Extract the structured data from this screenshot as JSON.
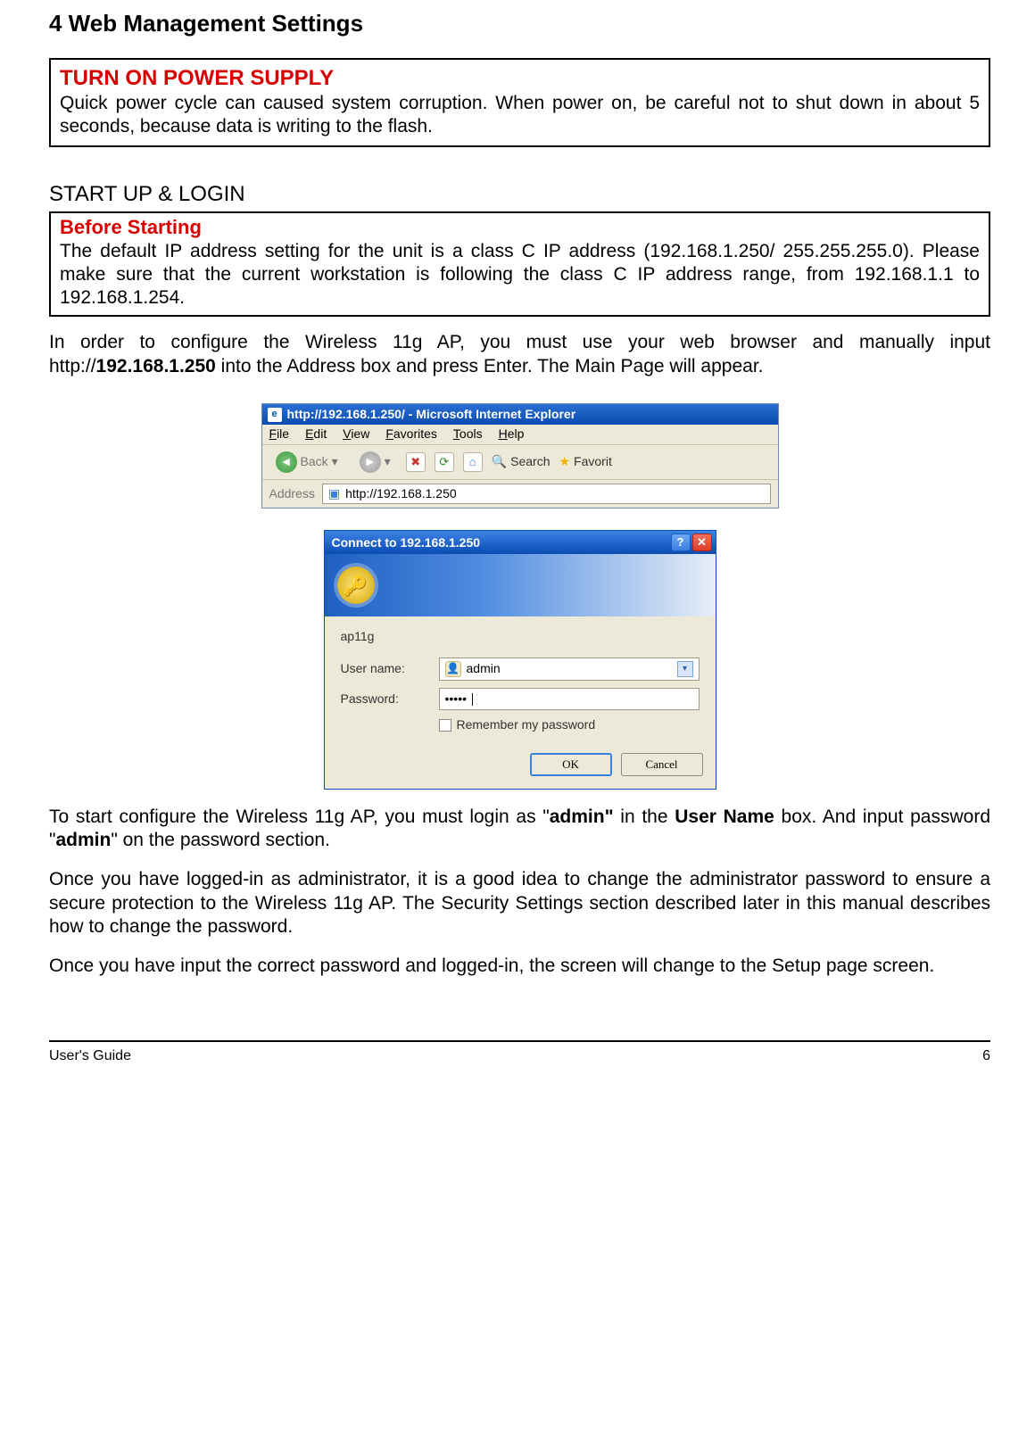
{
  "page": {
    "title": "4 Web Management Settings",
    "footer_left": "User's Guide",
    "footer_right": "6"
  },
  "warning": {
    "title": "TURN ON POWER SUPPLY",
    "body": "Quick power cycle can caused system corruption. When power on, be careful not to shut down in about 5 seconds, because data is writing to the flash."
  },
  "section_heading": "START UP & LOGIN",
  "before": {
    "title": "Before Starting",
    "body": "The default IP address setting for the unit is a class C IP address (192.168.1.250/ 255.255.255.0). Please make sure that the current workstation is following the class C IP address range, from 192.168.1.1 to 192.168.1.254."
  },
  "intro_para_pre": "In order to configure the Wireless 11g AP, you must use your web browser and manually input http://",
  "intro_para_bold": "192.168.1.250",
  "intro_para_post": " into the Address box and press Enter. The Main Page will appear.",
  "ie_window": {
    "title": "http://192.168.1.250/ - Microsoft Internet Explorer",
    "menu": [
      "File",
      "Edit",
      "View",
      "Favorites",
      "Tools",
      "Help"
    ],
    "back_label": "Back",
    "search_label": "Search",
    "favorites_label": "Favorit",
    "address_label": "Address",
    "address_value": "http://192.168.1.250"
  },
  "dialog": {
    "title": "Connect to 192.168.1.250",
    "realm": "ap11g",
    "user_label": "User name:",
    "pass_label": "Password:",
    "user_value": "admin",
    "pass_value": "•••••",
    "remember_label": "Remember my password",
    "ok": "OK",
    "cancel": "Cancel"
  },
  "para2_pre": "To start configure the Wireless 11g AP, you must login as \"",
  "para2_b1": "admin\"",
  "para2_mid": " in the ",
  "para2_b2": "User Name",
  "para2_mid2": " box. And input password \"",
  "para2_b3": "admin",
  "para2_post": "\" on the password section.",
  "para3": "Once you have logged-in as administrator, it is a good idea to change the administrator password to ensure a secure protection to the Wireless 11g AP. The Security Settings section described later in this manual describes how to change the password.",
  "para4": "Once you have input the correct password and logged-in, the screen will change to the Setup page screen."
}
